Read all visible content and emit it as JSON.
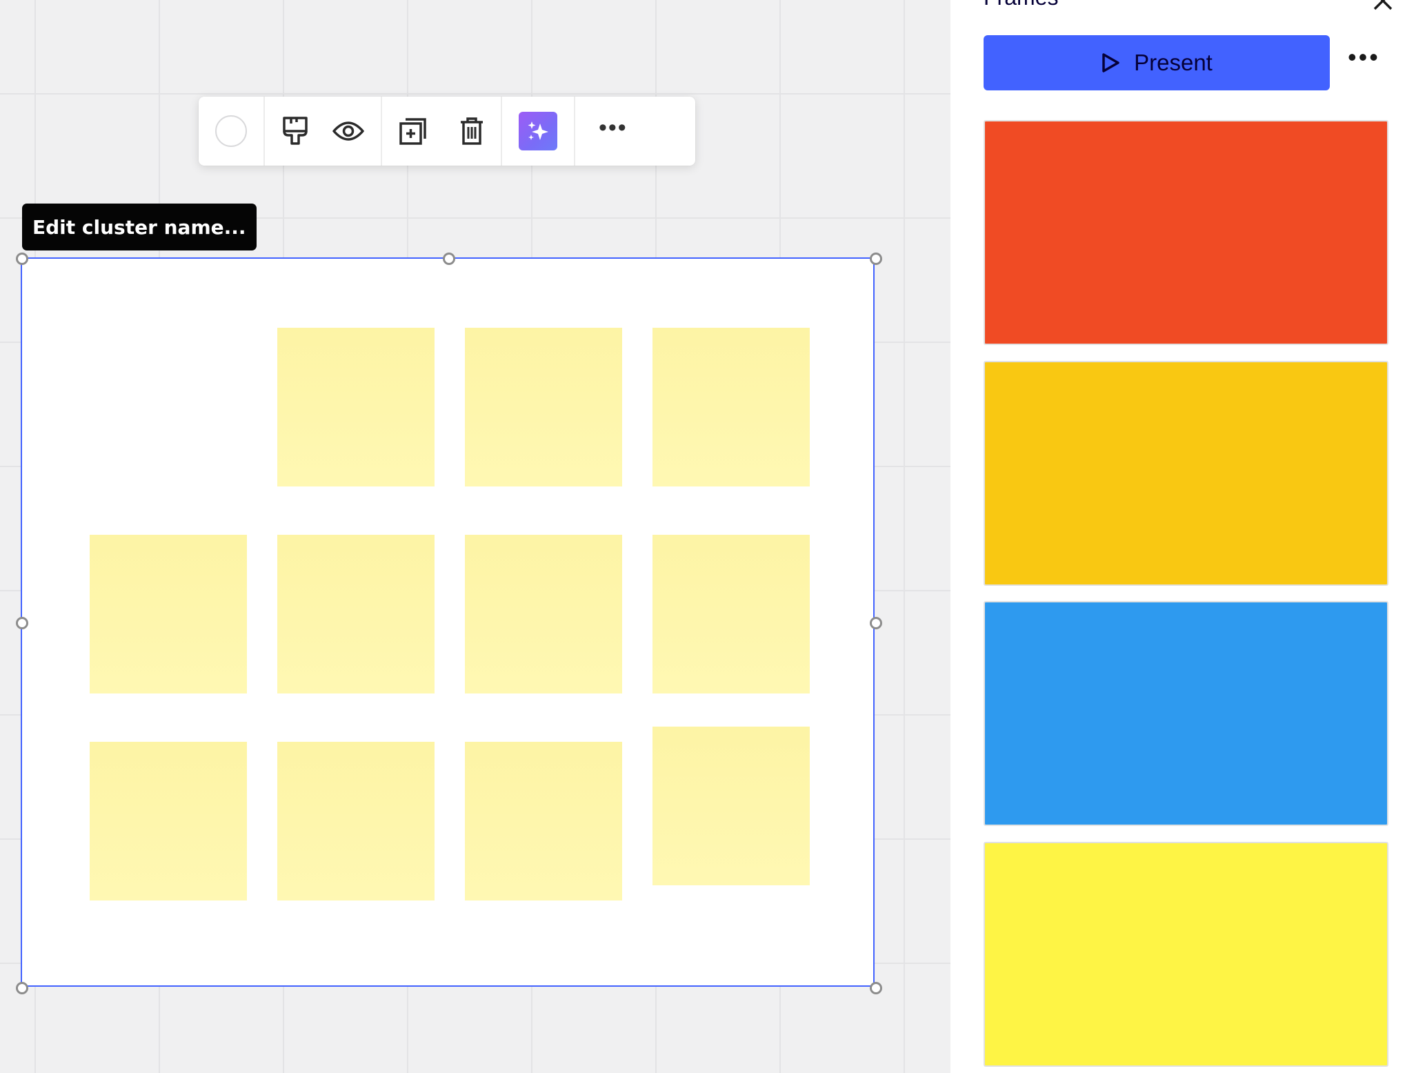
{
  "panel": {
    "title": "Frames",
    "present_label": "Present",
    "frames": [
      {
        "name": "frame-red",
        "color": "#f04b24"
      },
      {
        "name": "frame-orange",
        "color": "#f9c812"
      },
      {
        "name": "frame-blue",
        "color": "#2e9aef"
      },
      {
        "name": "frame-yellow",
        "color": "#fef445"
      }
    ]
  },
  "toolbar": {
    "icons": [
      "color-circle",
      "format-paint-icon",
      "eye-icon",
      "duplicate-icon",
      "trash-icon",
      "ai-sparkle-icon",
      "more-icon"
    ]
  },
  "cluster": {
    "tooltip": "Edit cluster name...",
    "sticky_color": "#fff6aa",
    "sticky_count": 11
  },
  "colors": {
    "accent": "#4262ff",
    "selection_border": "#4262ff"
  }
}
